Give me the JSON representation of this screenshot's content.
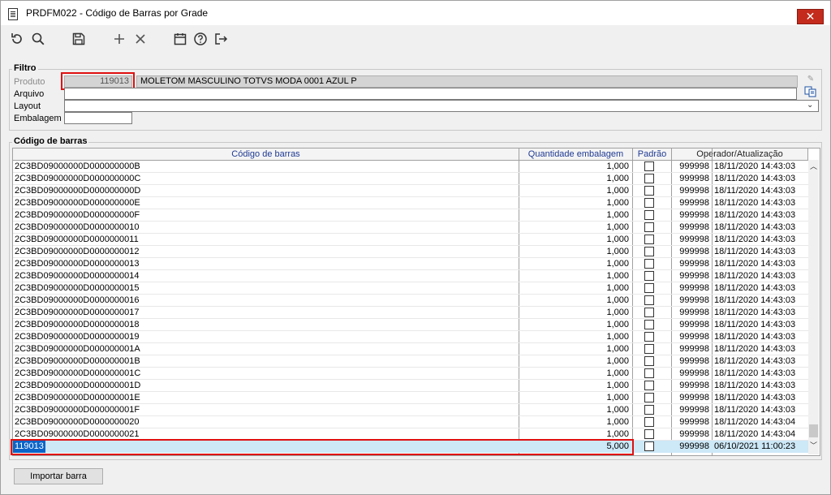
{
  "window": {
    "title": "PRDFM022 - Código de Barras por Grade",
    "close_glyph": "✕"
  },
  "toolbar": {
    "icons": [
      "refresh-icon",
      "search-icon",
      "save-icon",
      "add-icon",
      "delete-icon",
      "calendar-icon",
      "help-icon",
      "exit-icon"
    ]
  },
  "filtro": {
    "legend": "Filtro",
    "produto_label": "Produto",
    "produto_code": "119013",
    "produto_desc": "MOLETOM MASCULINO TOTVS MODA 0001 AZUL P",
    "arquivo_label": "Arquivo",
    "arquivo_value": "",
    "layout_label": "Layout",
    "layout_value": "",
    "embalagem_label": "Embalagem",
    "embalagem_value": ""
  },
  "barcodes": {
    "legend": "Código de barras",
    "columns": {
      "codigo": "Código de barras",
      "quantidade": "Quantidade embalagem",
      "padrao": "Padrão",
      "operador": "Operador/Atualização"
    },
    "rows": [
      {
        "codigo": "2C3BD09000000D000000000B",
        "qtd": "1,000",
        "op": "999998",
        "dt": "18/11/2020 14:43:03"
      },
      {
        "codigo": "2C3BD09000000D000000000C",
        "qtd": "1,000",
        "op": "999998",
        "dt": "18/11/2020 14:43:03"
      },
      {
        "codigo": "2C3BD09000000D000000000D",
        "qtd": "1,000",
        "op": "999998",
        "dt": "18/11/2020 14:43:03"
      },
      {
        "codigo": "2C3BD09000000D000000000E",
        "qtd": "1,000",
        "op": "999998",
        "dt": "18/11/2020 14:43:03"
      },
      {
        "codigo": "2C3BD09000000D000000000F",
        "qtd": "1,000",
        "op": "999998",
        "dt": "18/11/2020 14:43:03"
      },
      {
        "codigo": "2C3BD09000000D0000000010",
        "qtd": "1,000",
        "op": "999998",
        "dt": "18/11/2020 14:43:03"
      },
      {
        "codigo": "2C3BD09000000D0000000011",
        "qtd": "1,000",
        "op": "999998",
        "dt": "18/11/2020 14:43:03"
      },
      {
        "codigo": "2C3BD09000000D0000000012",
        "qtd": "1,000",
        "op": "999998",
        "dt": "18/11/2020 14:43:03"
      },
      {
        "codigo": "2C3BD09000000D0000000013",
        "qtd": "1,000",
        "op": "999998",
        "dt": "18/11/2020 14:43:03"
      },
      {
        "codigo": "2C3BD09000000D0000000014",
        "qtd": "1,000",
        "op": "999998",
        "dt": "18/11/2020 14:43:03"
      },
      {
        "codigo": "2C3BD09000000D0000000015",
        "qtd": "1,000",
        "op": "999998",
        "dt": "18/11/2020 14:43:03"
      },
      {
        "codigo": "2C3BD09000000D0000000016",
        "qtd": "1,000",
        "op": "999998",
        "dt": "18/11/2020 14:43:03"
      },
      {
        "codigo": "2C3BD09000000D0000000017",
        "qtd": "1,000",
        "op": "999998",
        "dt": "18/11/2020 14:43:03"
      },
      {
        "codigo": "2C3BD09000000D0000000018",
        "qtd": "1,000",
        "op": "999998",
        "dt": "18/11/2020 14:43:03"
      },
      {
        "codigo": "2C3BD09000000D0000000019",
        "qtd": "1,000",
        "op": "999998",
        "dt": "18/11/2020 14:43:03"
      },
      {
        "codigo": "2C3BD09000000D000000001A",
        "qtd": "1,000",
        "op": "999998",
        "dt": "18/11/2020 14:43:03"
      },
      {
        "codigo": "2C3BD09000000D000000001B",
        "qtd": "1,000",
        "op": "999998",
        "dt": "18/11/2020 14:43:03"
      },
      {
        "codigo": "2C3BD09000000D000000001C",
        "qtd": "1,000",
        "op": "999998",
        "dt": "18/11/2020 14:43:03"
      },
      {
        "codigo": "2C3BD09000000D000000001D",
        "qtd": "1,000",
        "op": "999998",
        "dt": "18/11/2020 14:43:03"
      },
      {
        "codigo": "2C3BD09000000D000000001E",
        "qtd": "1,000",
        "op": "999998",
        "dt": "18/11/2020 14:43:03"
      },
      {
        "codigo": "2C3BD09000000D000000001F",
        "qtd": "1,000",
        "op": "999998",
        "dt": "18/11/2020 14:43:03"
      },
      {
        "codigo": "2C3BD09000000D0000000020",
        "qtd": "1,000",
        "op": "999998",
        "dt": "18/11/2020 14:43:04"
      },
      {
        "codigo": "2C3BD09000000D0000000021",
        "qtd": "1,000",
        "op": "999998",
        "dt": "18/11/2020 14:43:04"
      }
    ],
    "edit_row": {
      "codigo": "119013",
      "qtd": "5,000",
      "op": "999998",
      "dt": "06/10/2021 11:00:23"
    }
  },
  "footer": {
    "importar_label": "Importar barra"
  },
  "colors": {
    "highlight": "#e01010",
    "selection": "#0a64c8",
    "edit_row_bg": "#cde8f7",
    "header_text": "#1f3a93"
  }
}
